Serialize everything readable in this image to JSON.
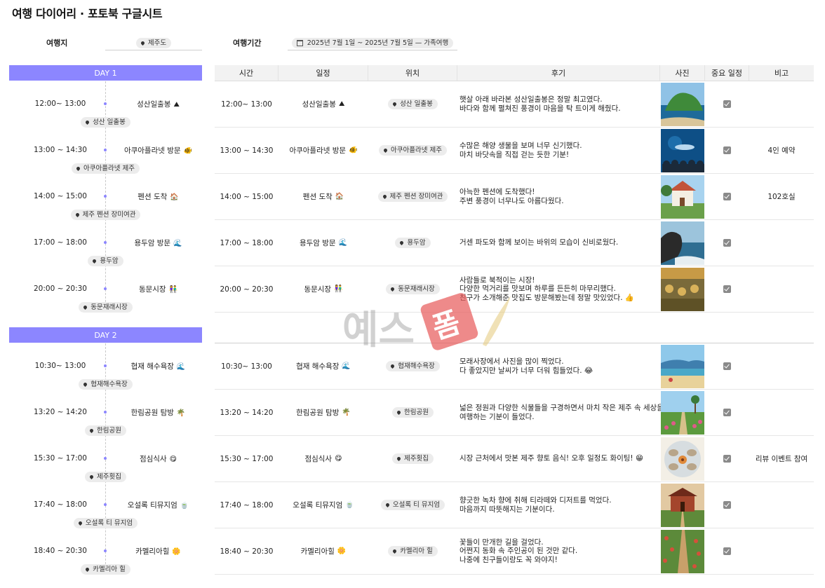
{
  "title": "여행 다이어리 · 포토북 구글시트",
  "meta": {
    "dest_label": "여행지",
    "dest_value": "제주도",
    "period_label": "여행기간",
    "period_value": "2025년 7월 1일 ~ 2025년 7월 5일 — 가족여행"
  },
  "headers": [
    "시간",
    "일정",
    "위치",
    "후기",
    "사진",
    "중요 일정",
    "비고"
  ],
  "days": [
    {
      "label": "DAY 1",
      "items": [
        {
          "time": "12:00~ 13:00",
          "act": "성산일출봉",
          "icon": "⛰",
          "tl_loc": "성산 일출봉",
          "loc": "성산 일출봉",
          "review": [
            "햇살 아래 바라본 성산일출봉은 정말 최고였다.",
            "바다와 함께 펼쳐진 풍경이 마음을 탁 트이게 해줬다."
          ],
          "note": ""
        },
        {
          "time": "13:00 ~ 14:30",
          "act": "아쿠아플라넷 방문",
          "icon": "🐠",
          "tl_loc": "아쿠아플라넷 제주",
          "loc": "아쿠아플라넷 제주",
          "review": [
            "수많은 해양 생물을 보며 너무 신기했다.",
            "마치 바닷속을 직접 걷는 듯한 기분!"
          ],
          "note": "4인 예약"
        },
        {
          "time": "14:00 ~ 15:00",
          "act": "펜션 도착",
          "icon": "🏠",
          "tl_loc": "제주 펜션 장미여관",
          "loc": "제주 펜션 장미여관",
          "review": [
            "아늑한 펜션에 도착했다!",
            "주변 풍경이 너무나도 아름다웠다."
          ],
          "note": "102호실"
        },
        {
          "time": "17:00 ~ 18:00",
          "act": "용두암 방문",
          "icon": "🌊",
          "tl_loc": "용두암",
          "loc": "용두암",
          "review": [
            "거센 파도와 함께 보이는 바위의 모습이 신비로웠다."
          ],
          "note": ""
        },
        {
          "time": "20:00 ~ 20:30",
          "act": "동문시장",
          "icon": "👫",
          "tl_loc": "동문재래시장",
          "loc": "동문재래시장",
          "review": [
            "사람들로 북적이는 시장!",
            "다양한 먹거리를 맛보며 하루를 든든히 마무리했다.",
            "친구가 소개해준 맛집도 방문해봤는데 정말 맛있었다. 👍"
          ],
          "note": ""
        }
      ]
    },
    {
      "label": "DAY 2",
      "items": [
        {
          "time": "10:30~ 13:00",
          "act": "협재 해수욕장",
          "icon": "🌊",
          "tl_loc": "협재해수욕장",
          "loc": "협재해수욕장",
          "review": [
            "모래사장에서 사진을 많이 찍었다.",
            "다 좋았지만 날씨가 너무 더워 힘들었다. 😂"
          ],
          "note": ""
        },
        {
          "time": "13:20 ~ 14:20",
          "act": "한림공원 탐방",
          "icon": "🌴",
          "tl_loc": "한림공원",
          "loc": "한림공원",
          "review": [
            "넓은 정원과 다양한 식물들을 구경하면서 마치 작은 제주 속 세상을",
            "여행하는 기분이 들었다."
          ],
          "note": ""
        },
        {
          "time": "15:30 ~ 17:00",
          "act": "점심식사",
          "icon": "😋",
          "tl_loc": "제주횟집",
          "loc": "제주횟집",
          "review": [
            "시장 근처에서 맛본 제주 향토 음식! 오후 일정도 화이팅! 😁"
          ],
          "note": "리뷰 이벤트 참여"
        },
        {
          "time": "17:40 ~ 18:00",
          "act": "오설록 티뮤지엄",
          "icon": "🍵",
          "tl_loc": "오설록 티 뮤지엄",
          "loc": "오설록 티 뮤지엄",
          "review": [
            "향긋한 녹차 향에 취해 티라떼와 디저트를 먹었다.",
            "마음까지 따뜻해지는 기분이다."
          ],
          "note": ""
        },
        {
          "time": "18:40 ~ 20:30",
          "act": "카멜리아힐",
          "icon": "🌼",
          "tl_loc": "카멜리아 힐",
          "loc": "카멜리아 힐",
          "review": [
            "꽃들이 만개한 길을 걸었다.",
            "어쩐지 동화 속 주인공이 된 것만 같다.",
            "나중에 친구들이랑도 꼭 와야지!"
          ],
          "note": ""
        }
      ]
    }
  ],
  "photos": [
    "cliff-sea",
    "aquarium",
    "cottage",
    "rock-waves",
    "market",
    "beach",
    "garden",
    "seafood",
    "brick-museum",
    "flower-path"
  ],
  "colors": {
    "accent": "#8c86ff",
    "header_bg": "#f2f2f2",
    "check": "#8a8a8a"
  },
  "watermark": "예스폼"
}
